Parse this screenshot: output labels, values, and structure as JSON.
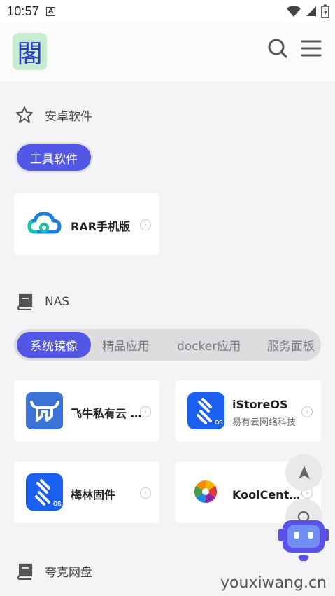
{
  "status_bar": {
    "time": "10:57",
    "notification_icon": "A"
  },
  "header": {
    "logo_char": "閣",
    "search_icon": "search-icon",
    "menu_icon": "menu-icon"
  },
  "sections": [
    {
      "title": "安卓软件",
      "icon": "star-icon",
      "tabs": [
        "工具软件"
      ],
      "active_tab": 0,
      "cards": [
        {
          "title": "RAR手机版",
          "subtitle": ""
        }
      ]
    },
    {
      "title": "NAS",
      "icon": "book-icon",
      "tabs": [
        "系统镜像",
        "精品应用",
        "docker应用",
        "服务面板"
      ],
      "active_tab": 0,
      "cards": [
        {
          "title": "飞牛私有云 fnOS",
          "subtitle": ""
        },
        {
          "title": "iStoreOS",
          "subtitle": "易有云网络科技"
        },
        {
          "title": "梅林固件",
          "subtitle": ""
        },
        {
          "title": "KoolCenter固件",
          "subtitle": ""
        }
      ]
    },
    {
      "title": "夸克网盘",
      "icon": "book-icon"
    }
  ],
  "fabs": [
    "navigation-arrow-icon",
    "search-icon",
    "robot-assistant-icon"
  ],
  "watermark": "youxiwang.cn",
  "colors": {
    "accent": "#5257e6",
    "background": "#f4f4f6",
    "card": "#ffffff",
    "feiniu_blue": "#3b72d8",
    "istore_blue": "#1a5ff0"
  }
}
